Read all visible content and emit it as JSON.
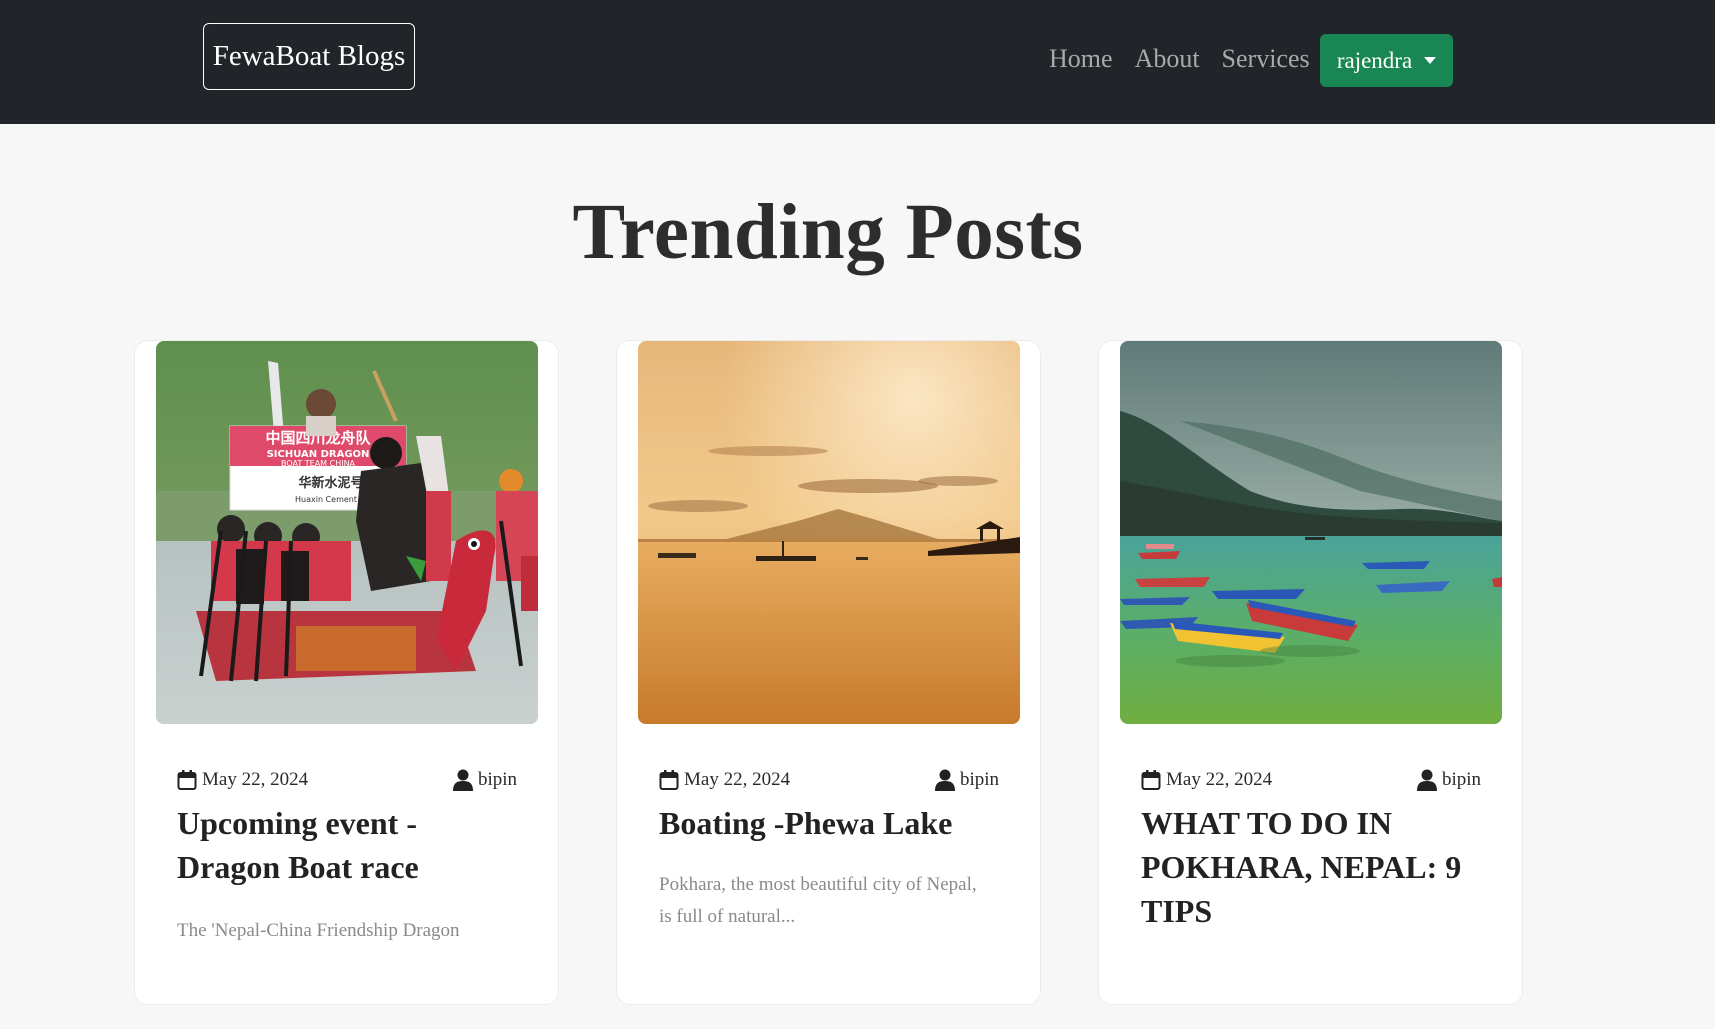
{
  "navbar": {
    "brand": "FewaBoat Blogs",
    "links": [
      "Home",
      "About",
      "Services"
    ],
    "user_menu": "rajendra"
  },
  "section": {
    "title": "Trending Posts"
  },
  "posts": [
    {
      "date": "May 22, 2024",
      "author": "bipin",
      "title": "Upcoming event - Dragon Boat race",
      "excerpt": "The 'Nepal-China Friendship Dragon",
      "image_sign_line1": "中国四川龙舟队",
      "image_sign_line2": "SICHUAN DRAGON",
      "image_sign_line3": "BOAT TEAM CHINA",
      "image_sign_line4": "华新水泥号",
      "image_sign_line5": "Huaxin Cement"
    },
    {
      "date": "May 22, 2024",
      "author": "bipin",
      "title": "Boating -Phewa Lake",
      "excerpt": "Pokhara, the most beautiful city of Nepal, is full of natural..."
    },
    {
      "date": "May 22, 2024",
      "author": "bipin",
      "title": "WHAT TO DO IN POKHARA, NEPAL: 9 TIPS",
      "excerpt": ""
    }
  ],
  "icons": {
    "date": "calendar-icon",
    "author": "user-icon",
    "menu": "caret-down-icon"
  },
  "colors": {
    "navbar": "#212529",
    "user_button": "#198754",
    "page_background": "#f7f7f7"
  }
}
